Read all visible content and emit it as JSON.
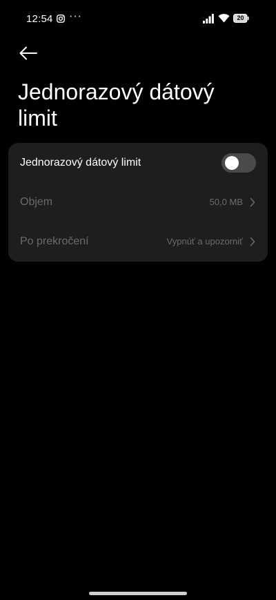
{
  "status_bar": {
    "time": "12:54",
    "dots": "···",
    "battery_level": "20",
    "icons": [
      "instagram-icon",
      "signal-icon",
      "wifi-icon",
      "battery-icon"
    ]
  },
  "header": {
    "back_icon": "arrow-left-icon",
    "title": "Jednorazový dátový limit"
  },
  "settings": {
    "toggle_row": {
      "label": "Jednorazový dátový limit",
      "enabled": false
    },
    "volume_row": {
      "label": "Objem",
      "value": "50,0 MB"
    },
    "after_exceed_row": {
      "label": "Po prekročení",
      "value": "Vypnúť a upozorniť"
    }
  },
  "colors": {
    "background": "#000000",
    "card": "#1e1e1e",
    "text_primary": "#ffffff",
    "text_disabled": "#6b6b6b",
    "toggle_off": "#4a4a4a"
  }
}
